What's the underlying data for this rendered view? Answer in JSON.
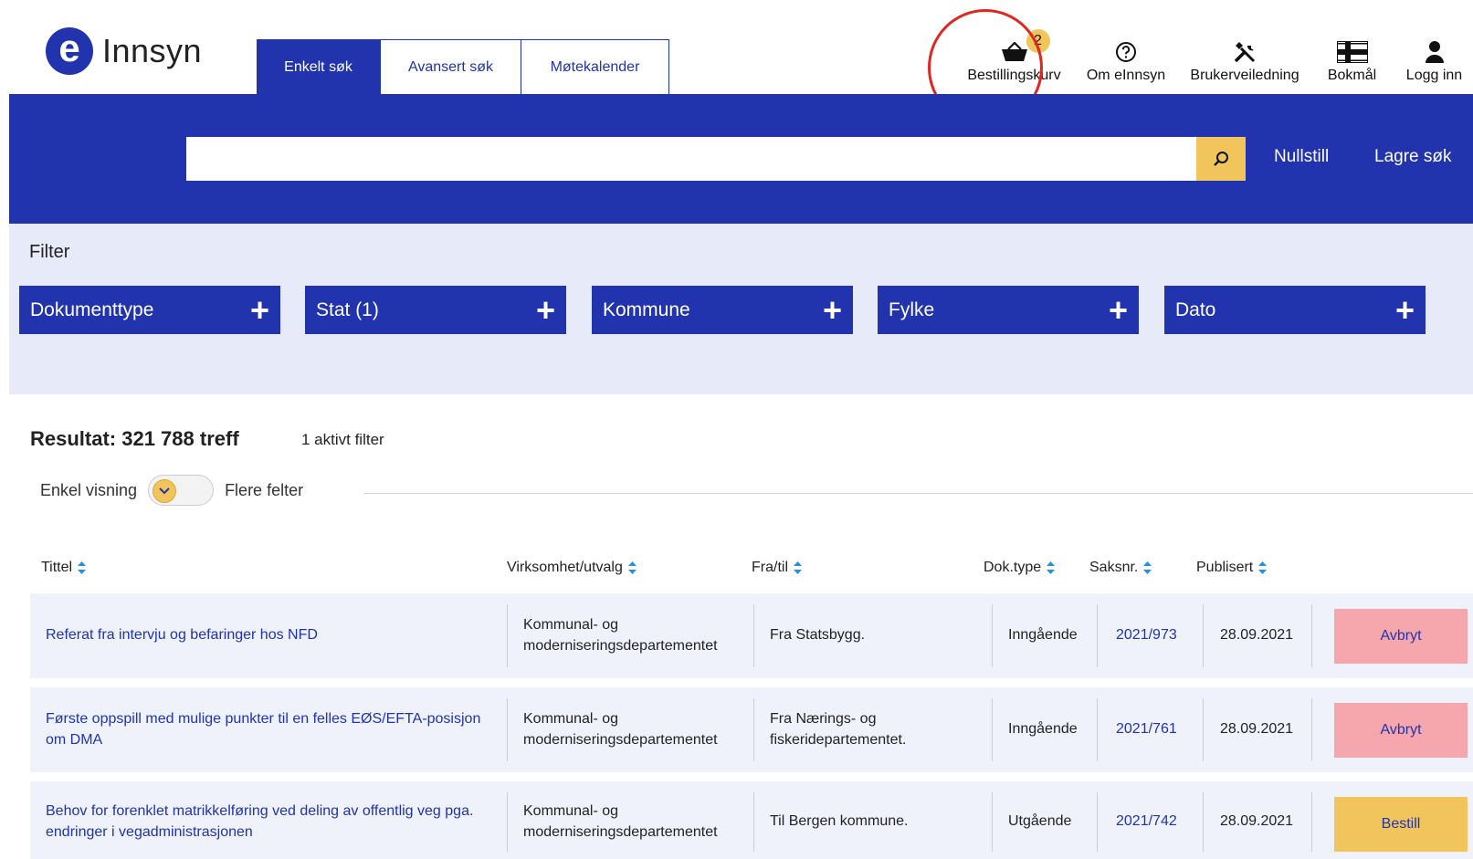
{
  "logo": {
    "mark": "e",
    "name": "Innsyn"
  },
  "tabs": [
    {
      "label": "Enkelt søk",
      "active": true
    },
    {
      "label": "Avansert søk",
      "active": false
    },
    {
      "label": "Møtekalender",
      "active": false
    }
  ],
  "topnav": {
    "basket": {
      "label": "Bestillingskurv",
      "count": "2",
      "icon": "basket-icon"
    },
    "about": {
      "label": "Om eInnsyn",
      "icon": "question-icon"
    },
    "guide": {
      "label": "Brukerveiledning",
      "icon": "tools-icon"
    },
    "language": {
      "label": "Bokmål",
      "icon": "norway-flag-icon"
    },
    "login": {
      "label": "Logg inn",
      "icon": "user-icon"
    }
  },
  "search": {
    "value": "",
    "placeholder": "",
    "reset_label": "Nullstill",
    "save_label": "Lagre søk"
  },
  "filter": {
    "title": "Filter",
    "items": [
      {
        "label": "Dokumenttype"
      },
      {
        "label": "Stat (1)"
      },
      {
        "label": "Kommune"
      },
      {
        "label": "Fylke"
      },
      {
        "label": "Dato"
      }
    ]
  },
  "results": {
    "title": "Resultat: 321 788 treff",
    "active_filters": "1 aktivt filter",
    "view_simple": "Enkel visning",
    "view_more": "Flere felter"
  },
  "table": {
    "columns": [
      "Tittel",
      "Virksomhet/utvalg",
      "Fra/til",
      "Dok.type",
      "Saksnr.",
      "Publisert"
    ],
    "rows": [
      {
        "title": "Referat fra intervju og befaringer hos NFD",
        "agency": "Kommunal- og moderniseringsdepartementet",
        "from_to": "Fra Statsbygg.",
        "doc_type": "Inngående",
        "case_no": "2021/973",
        "published": "28.09.2021",
        "action": "Avbryt"
      },
      {
        "title": "Første oppspill med mulige punkter til en felles EØS/EFTA-posisjon om DMA",
        "agency": "Kommunal- og moderniseringsdepartementet",
        "from_to": "Fra Nærings- og fiskeridepartementet.",
        "doc_type": "Inngående",
        "case_no": "2021/761",
        "published": "28.09.2021",
        "action": "Avbryt"
      },
      {
        "title": "Behov for forenklet matrikkelføring ved deling av offentlig veg pga. endringer i vegadministrasjonen",
        "agency": "Kommunal- og moderniseringsdepartementet",
        "from_to": "Til Bergen kommune.",
        "doc_type": "Utgående",
        "case_no": "2021/742",
        "published": "28.09.2021",
        "action": "Bestill"
      }
    ]
  },
  "colors": {
    "brand": "#2133ad",
    "accent": "#f2c55c",
    "cancel": "#f5a7ad",
    "filter_bg": "#e7eaf8",
    "row_bg": "#eff2fa",
    "highlight_ring": "#e0271f"
  }
}
